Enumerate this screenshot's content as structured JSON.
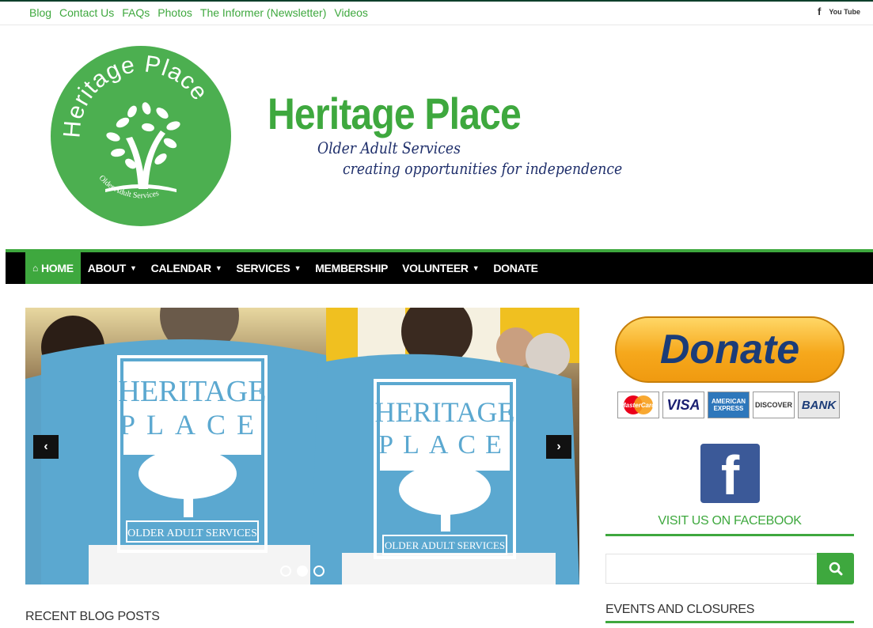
{
  "topbar": {
    "links": [
      "Blog",
      "Contact Us",
      "FAQs",
      "Photos",
      "The Informer (Newsletter)",
      "Videos"
    ],
    "social": {
      "facebook": "f",
      "youtube": "You Tube"
    }
  },
  "header": {
    "logo_text": "Heritage Place",
    "logo_subtext": "Older Adult Services",
    "site_title": "Heritage Place",
    "tagline_1": "Older Adult Services",
    "tagline_2": "creating opportunities for independence"
  },
  "nav": {
    "items": [
      {
        "label": "HOME",
        "icon": "home-icon",
        "dropdown": false
      },
      {
        "label": "ABOUT",
        "dropdown": true
      },
      {
        "label": "CALENDAR",
        "dropdown": true
      },
      {
        "label": "SERVICES",
        "dropdown": true
      },
      {
        "label": "MEMBERSHIP",
        "dropdown": false
      },
      {
        "label": "VOLUNTEER",
        "dropdown": true
      },
      {
        "label": "DONATE",
        "dropdown": false
      }
    ]
  },
  "slider": {
    "prev": "‹",
    "next": "›",
    "shirt_line1": "HERITAGE",
    "shirt_line2": "PLACE",
    "shirt_line3": "OLDER ADULT SERVICES",
    "slides": 3,
    "active": 2
  },
  "main": {
    "recent_heading": "RECENT BLOG POSTS"
  },
  "sidebar": {
    "donate_label": "Donate",
    "cards": [
      "MasterCard",
      "VISA",
      "AMERICAN EXPRESS",
      "DISCOVER",
      "BANK"
    ],
    "fb_letter": "f",
    "fb_visit": "VISIT US ON FACEBOOK",
    "search_placeholder": "",
    "events_heading": "EVENTS AND CLOSURES"
  },
  "colors": {
    "accent": "#3ea83e",
    "navy": "#1f2f6b",
    "nav_bg": "#000000",
    "facebook": "#3b5998"
  }
}
